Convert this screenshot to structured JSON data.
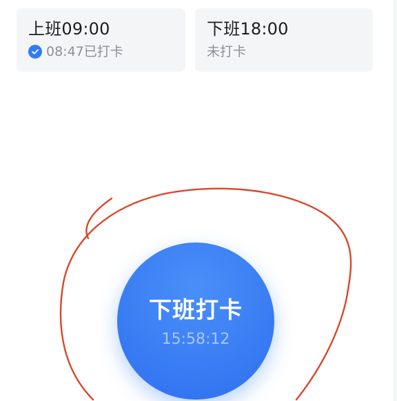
{
  "clock_in": {
    "title": "上班09:00",
    "status": "08:47已打卡",
    "status_icon": "check-circle-icon",
    "accent": "#2f7cf6"
  },
  "clock_out": {
    "title": "下班18:00",
    "status": "未打卡"
  },
  "punch": {
    "label": "下班打卡",
    "time": "15:58:12",
    "color": "#3a7ef4"
  },
  "annotation": {
    "color": "#d9462a"
  }
}
